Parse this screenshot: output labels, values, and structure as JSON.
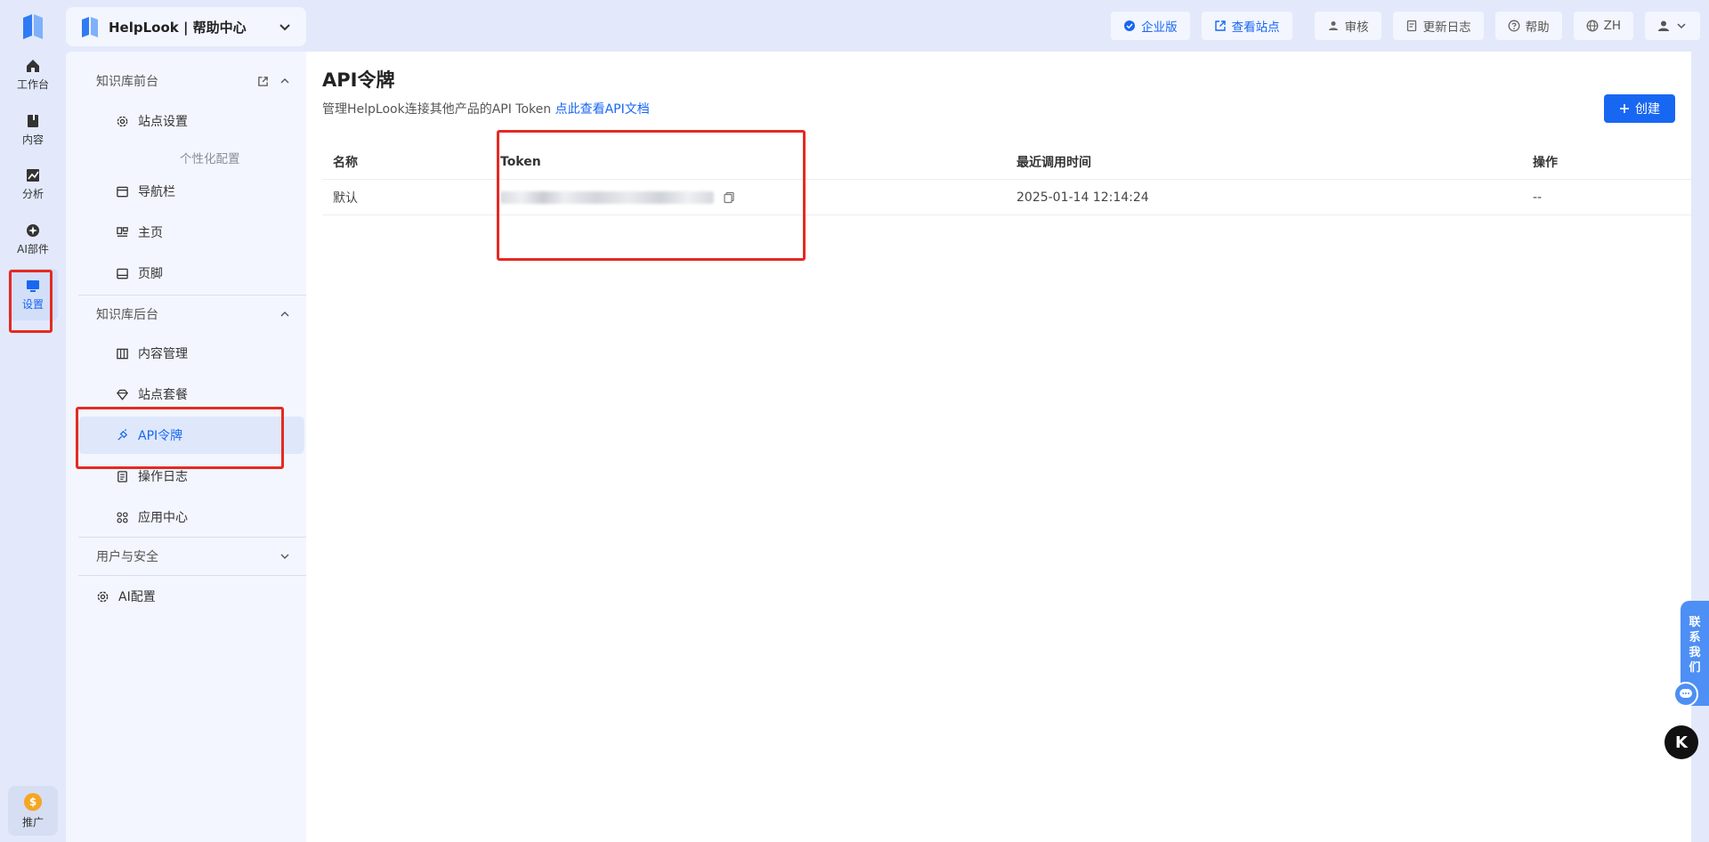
{
  "rail": {
    "items": [
      {
        "label": "工作台"
      },
      {
        "label": "内容"
      },
      {
        "label": "分析"
      },
      {
        "label": "AI部件"
      },
      {
        "label": "设置"
      }
    ],
    "promo": {
      "label": "推广",
      "coin": "$"
    }
  },
  "header": {
    "site_name": "HelpLook | 帮助中心",
    "actions": [
      {
        "label": "企业版",
        "icon": "check-circle-icon"
      },
      {
        "label": "查看站点",
        "icon": "external-link-icon"
      },
      {
        "label": "审核",
        "icon": "user-icon"
      },
      {
        "label": "更新日志",
        "icon": "doc-icon"
      },
      {
        "label": "帮助",
        "icon": "question-icon"
      },
      {
        "label": "ZH",
        "icon": "globe-icon"
      }
    ]
  },
  "sidebar": {
    "sec1": "知识库前台",
    "sec1_items": [
      "站点设置"
    ],
    "group_personal": "个性化配置",
    "personal_items": [
      "导航栏",
      "主页",
      "页脚"
    ],
    "sec2": "知识库后台",
    "sec2_items": [
      "内容管理",
      "站点套餐",
      "API令牌",
      "操作日志",
      "应用中心"
    ],
    "sec3": "用户与安全",
    "ai_config": "AI配置"
  },
  "main": {
    "title": "API令牌",
    "subtitle": "管理HelpLook连接其他产品的API Token",
    "doc_link": "点此查看API文档",
    "create_label": "创建",
    "table": {
      "headers": [
        "名称",
        "Token",
        "最近调用时间",
        "操作"
      ],
      "rows": [
        {
          "name": "默认",
          "last_called": "2025-01-14 12:14:24",
          "action": "--"
        }
      ]
    }
  },
  "float": {
    "contact": [
      "联",
      "系",
      "我",
      "们"
    ],
    "k_label": "K"
  },
  "colors": {
    "accent": "#1867f2",
    "highlight": "#e42a22",
    "rail_bg": "#e3e9fb"
  }
}
